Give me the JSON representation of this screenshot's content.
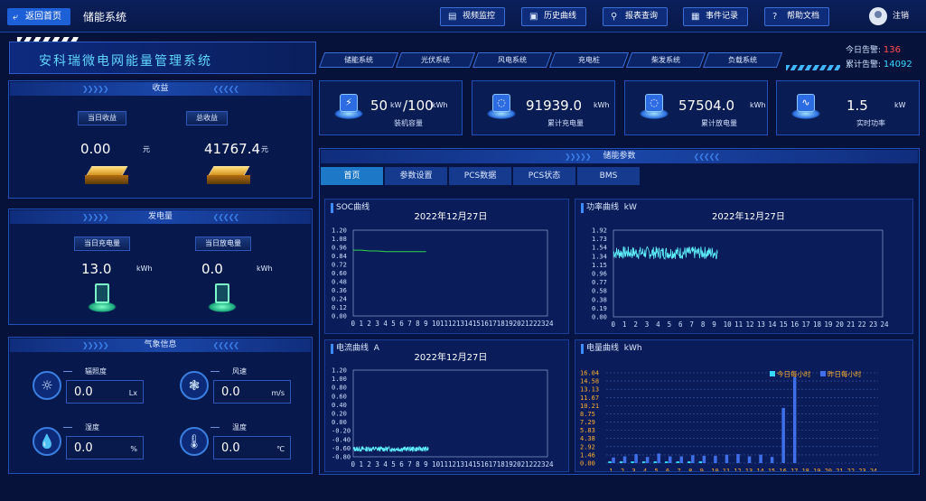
{
  "topbar": {
    "back_label": "返回首页",
    "system_title": "储能系统",
    "nav": [
      {
        "label": "视频监控",
        "icon": "video-icon"
      },
      {
        "label": "历史曲线",
        "icon": "history-icon"
      },
      {
        "label": "报表查询",
        "icon": "report-search-icon"
      },
      {
        "label": "事件记录",
        "icon": "event-log-icon"
      },
      {
        "label": "帮助文档",
        "icon": "help-icon"
      }
    ],
    "user_label": "注销"
  },
  "header": {
    "title": "安科瑞微电网能量管理系统",
    "system_tabs": [
      "储能系统",
      "光伏系统",
      "风电系统",
      "充电桩",
      "柴发系统",
      "负载系统"
    ],
    "alarm_today_label": "今日告警:",
    "alarm_today_value": "136",
    "alarm_total_label": "累计告警:",
    "alarm_total_value": "14092"
  },
  "income": {
    "title": "收益",
    "today_label": "当日收益",
    "today_value": "0.00",
    "today_unit": "元",
    "total_label": "总收益",
    "total_value": "41767.4",
    "total_unit": "元"
  },
  "energy": {
    "title": "发电量",
    "charge_label": "当日充电量",
    "charge_value": "13.0",
    "charge_unit": "kWh",
    "discharge_label": "当日放电量",
    "discharge_value": "0.0",
    "discharge_unit": "kWh"
  },
  "weather": {
    "title": "气象信息",
    "items": [
      {
        "label": "辐照度",
        "value": "0.0",
        "unit": "Lx",
        "icon": "sun-icon"
      },
      {
        "label": "风速",
        "value": "0.0",
        "unit": "m/s",
        "icon": "fan-icon"
      },
      {
        "label": "湿度",
        "value": "0.0",
        "unit": "%",
        "icon": "humidity-icon"
      },
      {
        "label": "温度",
        "value": "0.0",
        "unit": "℃",
        "icon": "thermometer-icon"
      }
    ]
  },
  "stats": [
    {
      "value": "50",
      "unit": "kW",
      "extra": "/100",
      "extra_unit": "kWh",
      "label": "装机容量",
      "icon": "capacity-icon"
    },
    {
      "value": "91939.0",
      "unit": "kWh",
      "label": "累计充电量",
      "icon": "charge-gauge-icon"
    },
    {
      "value": "57504.0",
      "unit": "kWh",
      "label": "累计放电量",
      "icon": "discharge-gauge-icon"
    },
    {
      "value": "1.5",
      "unit": "kW",
      "label": "实时功率",
      "icon": "power-wave-icon"
    }
  ],
  "params": {
    "title": "储能参数",
    "tabs": [
      "首页",
      "参数设置",
      "PCS数据",
      "PCS状态",
      "BMS"
    ]
  },
  "colors": {
    "accent": "#1e78c8",
    "soc_line": "#2fd34a",
    "power_line": "#5ff2ff",
    "today_bar": "#35d8ff",
    "yesterday_bar": "#3f6fe8",
    "alarm_today": "#ff4d4d",
    "alarm_total": "#39d7ff"
  },
  "chart_data": [
    {
      "type": "line",
      "title": "SOC曲线",
      "date_label": "2022年12月27日",
      "yticks": [
        "1.20",
        "1.08",
        "0.96",
        "0.84",
        "0.72",
        "0.60",
        "0.48",
        "0.36",
        "0.24",
        "0.12",
        "0.00"
      ],
      "xticks": [
        "0",
        "1",
        "2",
        "3",
        "4",
        "5",
        "6",
        "7",
        "8",
        "9",
        "10",
        "11",
        "12",
        "13",
        "14",
        "15",
        "16",
        "17",
        "18",
        "19",
        "20",
        "21",
        "22",
        "23",
        "24"
      ],
      "ylim": [
        0,
        1.2
      ],
      "xlim": [
        0,
        24
      ],
      "series": [
        {
          "x": [
            0,
            1,
            2,
            3,
            4,
            5,
            6,
            7,
            8,
            9
          ],
          "y": [
            0.92,
            0.92,
            0.91,
            0.91,
            0.9,
            0.9,
            0.9,
            0.9,
            0.9,
            0.9
          ]
        }
      ]
    },
    {
      "type": "line",
      "title": "功率曲线",
      "unit_label": "kW",
      "date_label": "2022年12月27日",
      "yticks": [
        "1.92",
        "1.73",
        "1.54",
        "1.34",
        "1.15",
        "0.96",
        "0.77",
        "0.58",
        "0.38",
        "0.19",
        "0.00"
      ],
      "xticks": [
        "0",
        "1",
        "2",
        "3",
        "4",
        "5",
        "6",
        "7",
        "8",
        "9",
        "10",
        "11",
        "12",
        "13",
        "14",
        "15",
        "16",
        "17",
        "18",
        "19",
        "20",
        "21",
        "22",
        "23",
        "24"
      ],
      "ylim": [
        0,
        1.92
      ],
      "xlim": [
        0,
        24
      ],
      "series": [
        {
          "x_start": 0,
          "x_end": 9.3,
          "y_mean": 1.42,
          "y_amp": 0.14
        }
      ]
    },
    {
      "type": "line",
      "title": "电流曲线",
      "unit_label": "A",
      "date_label": "2022年12月27日",
      "yticks": [
        "1.20",
        "1.00",
        "0.80",
        "0.60",
        "0.40",
        "0.20",
        "0.00",
        "-0.20",
        "-0.40",
        "-0.60",
        "-0.80"
      ],
      "xticks": [
        "0",
        "1",
        "2",
        "3",
        "4",
        "5",
        "6",
        "7",
        "8",
        "9",
        "10",
        "11",
        "12",
        "13",
        "14",
        "15",
        "16",
        "17",
        "18",
        "19",
        "20",
        "21",
        "22",
        "23",
        "24"
      ],
      "ylim": [
        -0.8,
        1.2
      ],
      "xlim": [
        0,
        24
      ],
      "series": [
        {
          "x_start": 0,
          "x_end": 9.3,
          "y_mean": -0.62,
          "y_amp": 0.06
        }
      ]
    },
    {
      "type": "bar",
      "title": "电量曲线",
      "unit_label": "kWh",
      "yticks": [
        "16.04",
        "14.58",
        "13.13",
        "11.67",
        "10.21",
        "8.75",
        "7.29",
        "5.83",
        "4.38",
        "2.92",
        "1.46",
        "0.00"
      ],
      "categories": [
        "1",
        "2",
        "3",
        "4",
        "5",
        "6",
        "7",
        "8",
        "9",
        "10",
        "11",
        "12",
        "13",
        "14",
        "15",
        "16",
        "17",
        "18",
        "19",
        "20",
        "21",
        "22",
        "23",
        "24"
      ],
      "ylim": [
        0,
        16.04
      ],
      "legend_position": "top-right",
      "series": [
        {
          "name": "今日每小时",
          "values": [
            0.3,
            0.3,
            0.3,
            0.3,
            0.3,
            0.3,
            0.3,
            0.3,
            0.3,
            0,
            0,
            0,
            0,
            0,
            0,
            0,
            0,
            0,
            0,
            0,
            0,
            0,
            0,
            0
          ]
        },
        {
          "name": "昨日每小时",
          "values": [
            1.0,
            1.2,
            1.6,
            1.1,
            1.7,
            1.2,
            1.2,
            1.4,
            1.3,
            1.3,
            1.5,
            1.6,
            1.2,
            1.5,
            1.1,
            9.8,
            15.3,
            0,
            0,
            0,
            0,
            0,
            0,
            0
          ]
        }
      ]
    }
  ]
}
